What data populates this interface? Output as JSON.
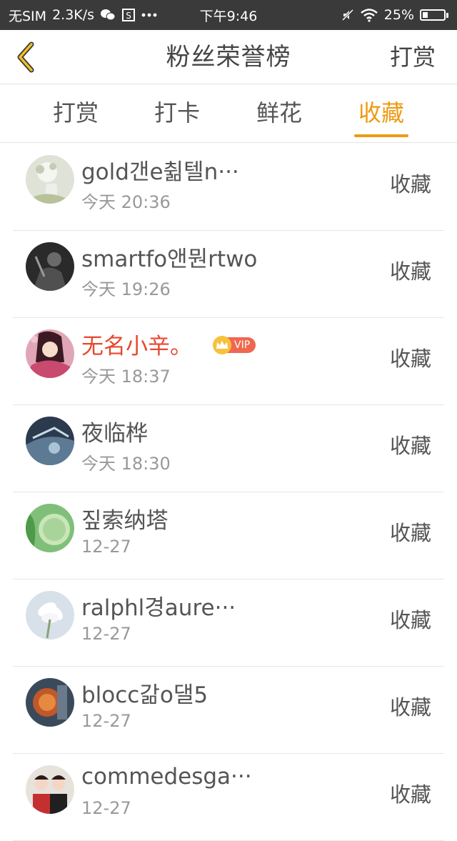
{
  "status_bar": {
    "carrier": "无SIM",
    "speed": "2.3K/s",
    "time": "下午9:46",
    "battery": "25%",
    "battery_level": 0.25,
    "icons": [
      "wechat-icon",
      "notification-icon",
      "more-icon",
      "mute-icon",
      "wifi-icon",
      "battery-icon"
    ]
  },
  "header": {
    "title": "粉丝荣誉榜",
    "action_label": "打赏",
    "back_icon": "chevron-left-icon",
    "accent_color": "#ee9a12"
  },
  "tabs": [
    {
      "label": "打赏",
      "active": false
    },
    {
      "label": "打卡",
      "active": false
    },
    {
      "label": "鲜花",
      "active": false
    },
    {
      "label": "收藏",
      "active": true
    }
  ],
  "list": {
    "action_label": "收藏",
    "items": [
      {
        "name": "gold갠e췲텔n···",
        "time": "今天 20:36",
        "vip": false
      },
      {
        "name": "smartfo앤뭔rtwo",
        "time": "今天 19:26",
        "vip": false
      },
      {
        "name": "无名小辛。",
        "time": "今天 18:37",
        "vip": true,
        "vip_label": "VIP"
      },
      {
        "name": "夜临桦",
        "time": "今天 18:30",
        "vip": false
      },
      {
        "name": "짚索纳塔",
        "time": "12-27",
        "vip": false
      },
      {
        "name": "ralphl경aure···",
        "time": "12-27",
        "vip": false
      },
      {
        "name": "blocc갊o댈5",
        "time": "12-27",
        "vip": false
      },
      {
        "name": "commedesga···",
        "time": "12-27",
        "vip": false
      }
    ]
  }
}
